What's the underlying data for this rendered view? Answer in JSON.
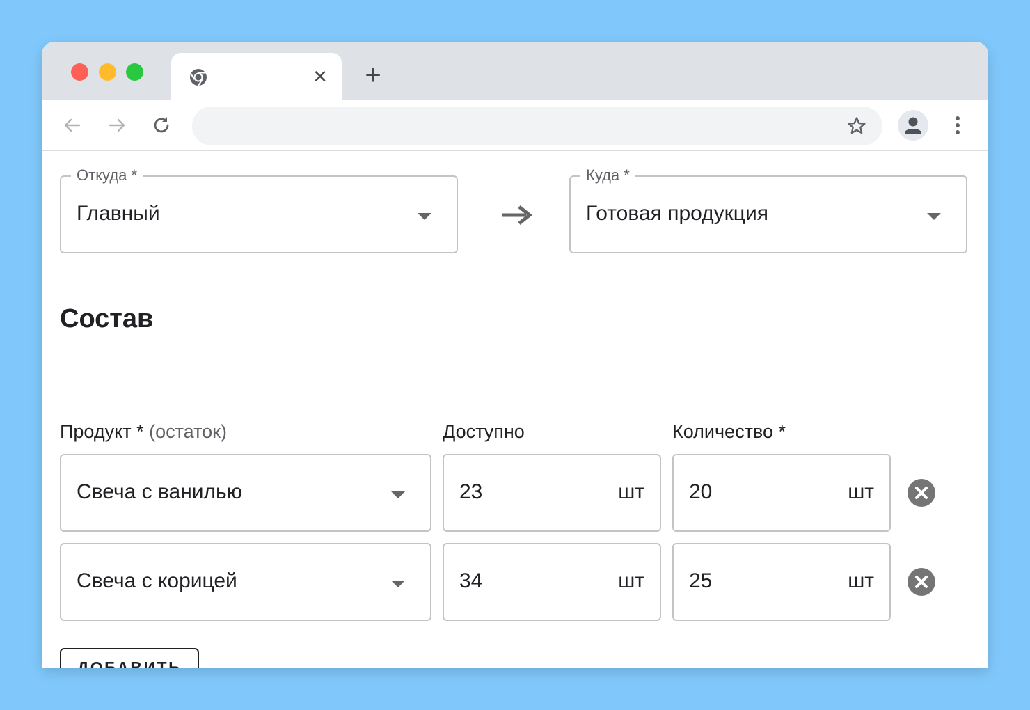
{
  "browser": {
    "tab_title": "",
    "tab_close_glyph": "✕",
    "new_tab_glyph": "+",
    "address": ""
  },
  "transfer": {
    "from": {
      "label": "Откуда *",
      "value": "Главный"
    },
    "to": {
      "label": "Куда *",
      "value": "Готовая продукция"
    }
  },
  "composition": {
    "title": "Состав",
    "columns": {
      "product": "Продукт *",
      "product_hint": "(остаток)",
      "available": "Доступно",
      "quantity": "Количество *"
    },
    "rows": [
      {
        "product": "Свеча с ванилью",
        "available": "23",
        "available_unit": "шт",
        "quantity": "20",
        "quantity_unit": "шт"
      },
      {
        "product": "Свеча с корицей",
        "available": "34",
        "available_unit": "шт",
        "quantity": "25",
        "quantity_unit": "шт"
      }
    ],
    "add_button": "ДОБАВИТЬ"
  },
  "icons": {
    "favicon": "chrome-icon",
    "back": "arrow-left-icon",
    "forward": "arrow-right-icon",
    "reload": "reload-icon",
    "bookmark": "star-icon",
    "profile": "person-icon",
    "menu": "kebab-icon",
    "direction": "arrow-right-icon",
    "dropdown": "caret-down-icon",
    "remove": "close-circle-icon"
  },
  "colors": {
    "background": "#80c8fb",
    "tabstrip": "#dee1e6",
    "omnibox": "#f1f3f4",
    "field_border": "#c4c4c4",
    "remove_button": "#757575",
    "traffic_red": "#fe5f57",
    "traffic_yellow": "#febb2e",
    "traffic_green": "#28c840"
  }
}
